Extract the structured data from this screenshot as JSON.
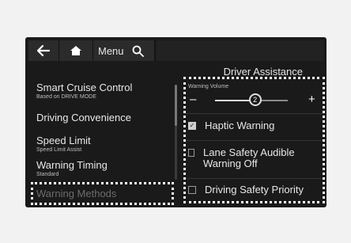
{
  "toolbar": {
    "menu_label": "Menu"
  },
  "panel_title": "Driver Assistance",
  "left_menu": [
    {
      "label": "Smart Cruise Control",
      "sub": "Based on DRIVE MODE"
    },
    {
      "label": "Driving Convenience",
      "sub": ""
    },
    {
      "label": "Speed Limit",
      "sub": "Speed Limit Assist"
    },
    {
      "label": "Warning Timing",
      "sub": "Standard"
    },
    {
      "label": "Warning Methods",
      "sub": ""
    }
  ],
  "warning_volume": {
    "label": "Warning Volume",
    "minus": "–",
    "plus": "+",
    "value": "2",
    "level_fraction": 0.55
  },
  "options": [
    {
      "label": "Haptic Warning",
      "checked": true
    },
    {
      "label": "Lane Safety Audible Warning Off",
      "checked": false
    },
    {
      "label": "Driving Safety Priority",
      "checked": false
    }
  ],
  "icons": {
    "back": "back-arrow-icon",
    "home": "home-icon",
    "search": "search-icon",
    "check": "check-icon"
  }
}
